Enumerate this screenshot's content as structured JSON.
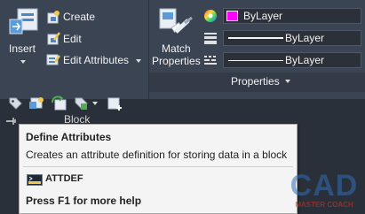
{
  "block_panel": {
    "insert_label": "Insert",
    "create_label": "Create",
    "edit_label": "Edit",
    "edit_attributes_label": "Edit Attributes",
    "panel_title": "Block"
  },
  "properties_panel": {
    "match_properties_line1": "Match",
    "match_properties_line2": "Properties",
    "color_value": "ByLayer",
    "linetype_value": "ByLayer",
    "lineweight_value": "ByLayer",
    "panel_title": "Properties"
  },
  "tooltip": {
    "title": "Define Attributes",
    "description": "Creates an attribute definition for storing data in a block",
    "command": "ATTDEF",
    "help": "Press F1 for more help"
  },
  "watermark": {
    "logo_text": "CAD",
    "sub_text": "MASTER COACH"
  },
  "colors": {
    "ribbon_bg": "#3b4453",
    "tooltip_bg": "#f4f4f4",
    "bylayer_swatch": "#ff00ff",
    "watermark_blue": "#2f6db5"
  }
}
